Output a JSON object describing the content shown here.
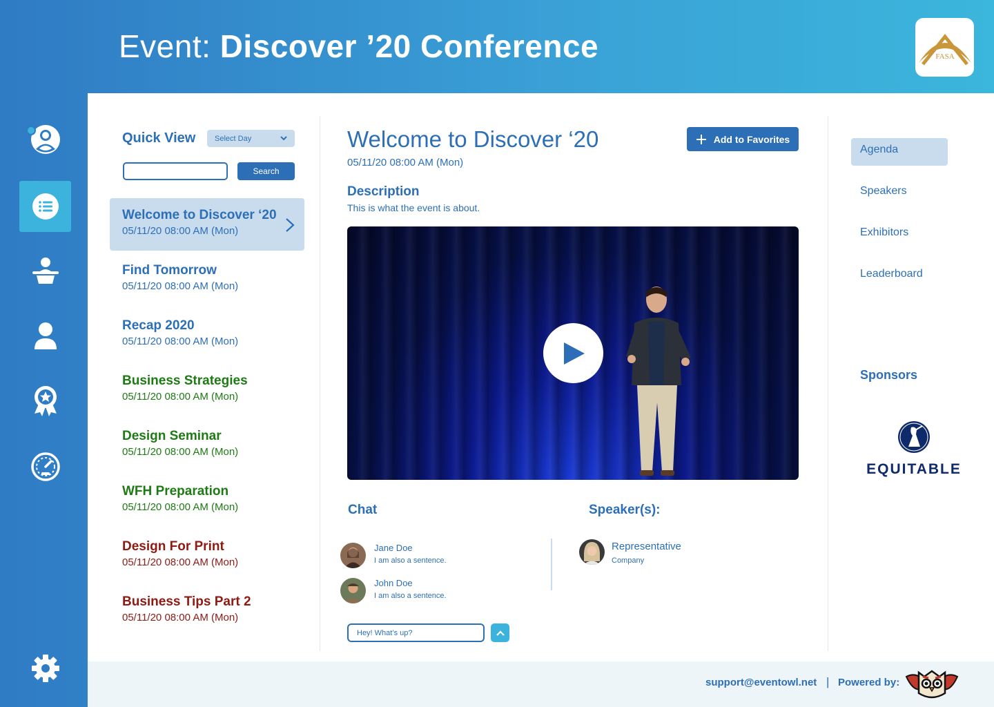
{
  "header": {
    "title_prefix": "Event:",
    "title_name": "Discover ’20 Conference",
    "logo_text": "FASA"
  },
  "sidebar": {
    "items": [
      {
        "icon": "profile-icon"
      },
      {
        "icon": "agenda-list-icon",
        "active": true
      },
      {
        "icon": "presenter-icon"
      },
      {
        "icon": "person-icon"
      },
      {
        "icon": "award-badge-icon"
      },
      {
        "icon": "dashboard-gauge-icon"
      }
    ],
    "settings_icon": "gear-icon"
  },
  "quick_view": {
    "title": "Quick View",
    "select_day": "Select Day",
    "search_value": "",
    "search_label": "Search"
  },
  "agenda": [
    {
      "title": "Welcome to Discover ‘20",
      "date": "05/11/20  08:00 AM  (Mon)",
      "color": "#2d6fb6",
      "active": true
    },
    {
      "title": "Find Tomorrow",
      "date": "05/11/20  08:00 AM  (Mon)",
      "color": "#2d6fb6"
    },
    {
      "title": "Recap 2020",
      "date": "05/11/20  08:00 AM  (Mon)",
      "color": "#2d6fb6"
    },
    {
      "title": "Business Strategies",
      "date": "05/11/20  08:00 AM  (Mon)",
      "color": "#1e7a14"
    },
    {
      "title": "Design Seminar",
      "date": "05/11/20  08:00 AM  (Mon)",
      "color": "#1e7a14"
    },
    {
      "title": "WFH Preparation",
      "date": "05/11/20  08:00 AM  (Mon)",
      "color": "#1e7a14"
    },
    {
      "title": "Design For Print",
      "date": "05/11/20  08:00 AM  (Mon)",
      "color": "#8e1a12"
    },
    {
      "title": "Business Tips Part 2",
      "date": "05/11/20  08:00 AM  (Mon)",
      "color": "#8e1a12"
    }
  ],
  "event": {
    "title": "Welcome to Discover ‘20",
    "date": "05/11/20  08:00 AM  (Mon)",
    "favorites_label": "Add to Favorites",
    "description_heading": "Description",
    "description_text": "This is what the event is about."
  },
  "chat": {
    "heading": "Chat",
    "messages": [
      {
        "name": "Jane Doe",
        "text": "I am also a sentence."
      },
      {
        "name": "John Doe",
        "text": "I am also a sentence."
      }
    ],
    "input_value": "Hey! What’s up?"
  },
  "speakers": {
    "heading": "Speaker(s):",
    "items": [
      {
        "name": "Representative",
        "company": "Company"
      }
    ]
  },
  "right_nav": {
    "items": [
      {
        "label": "Agenda",
        "active": true
      },
      {
        "label": "Speakers"
      },
      {
        "label": "Exhibitors"
      },
      {
        "label": "Leaderboard"
      }
    ],
    "sponsors_heading": "Sponsors",
    "sponsor_name": "EQUITABLE"
  },
  "footer": {
    "email": "support@eventowl.net",
    "separator": "|",
    "powered_label": "Powered by:"
  },
  "colors": {
    "brand_blue": "#2d6fb6",
    "accent_cyan": "#3bb3dc",
    "active_bg": "#c9dcee",
    "green": "#1e7a14",
    "red": "#8e1a12"
  }
}
